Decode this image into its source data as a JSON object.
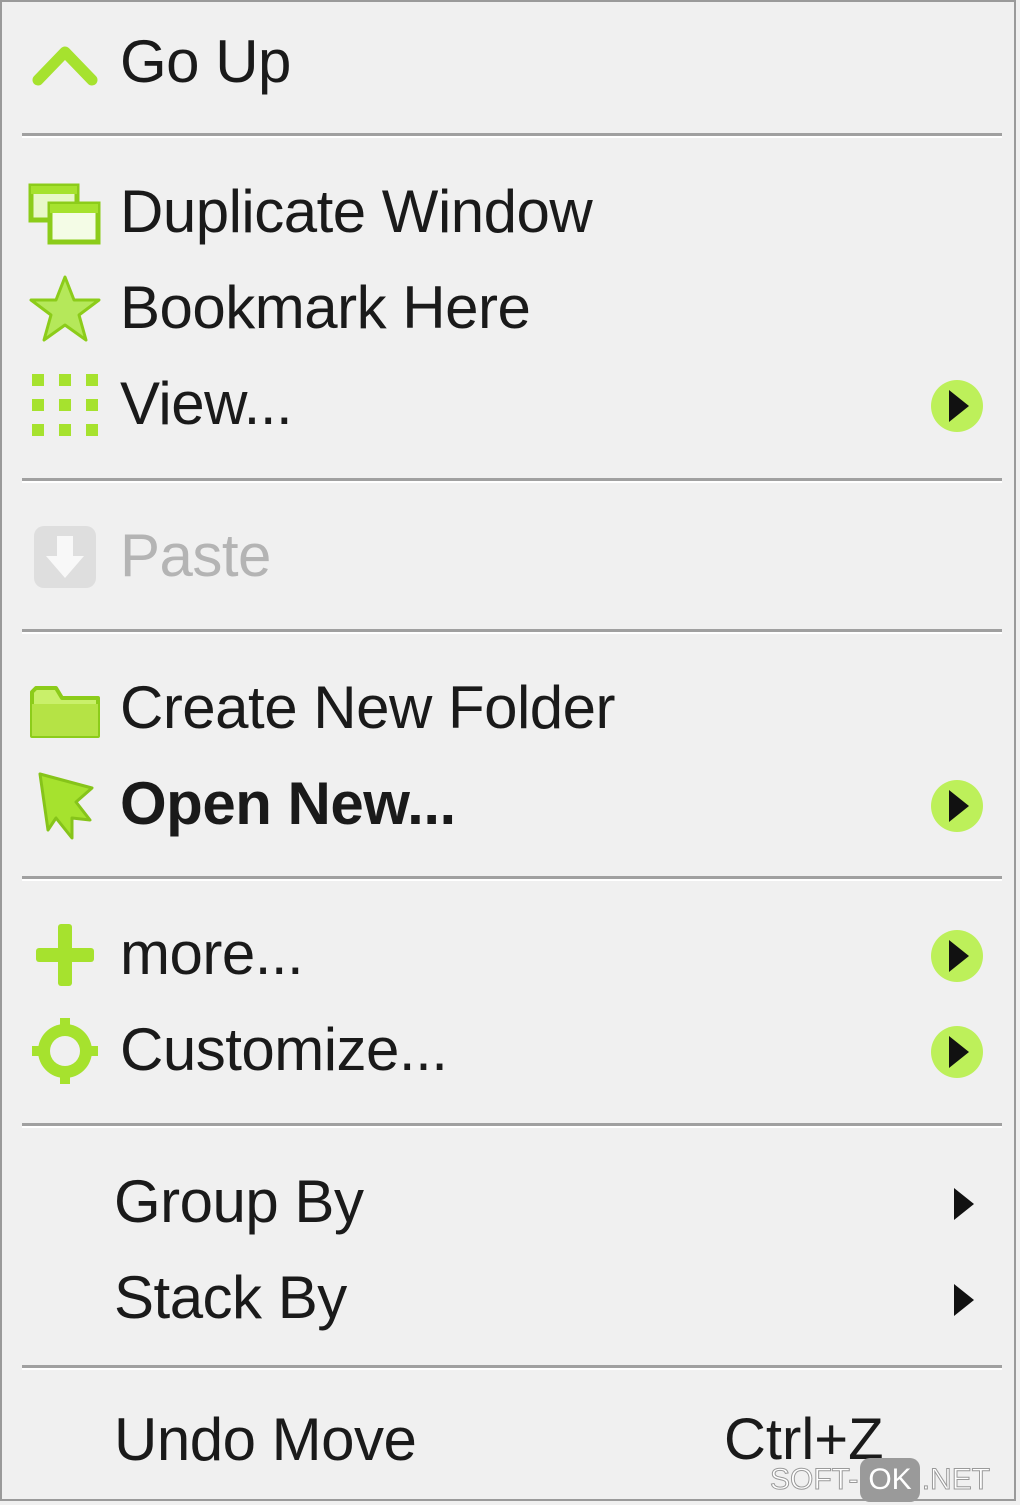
{
  "menu": {
    "items": [
      {
        "label": "Go Up",
        "icon": "go-up-icon"
      },
      {
        "label": "Duplicate Window",
        "icon": "duplicate-window-icon"
      },
      {
        "label": "Bookmark Here",
        "icon": "star-icon"
      },
      {
        "label": "View...",
        "icon": "view-grid-icon",
        "submenu": true
      },
      {
        "label": "Paste",
        "icon": "paste-icon",
        "disabled": true
      },
      {
        "label": "Create New Folder",
        "icon": "folder-icon"
      },
      {
        "label": "Open New...",
        "icon": "open-new-flag-icon",
        "submenu": true,
        "bold": true
      },
      {
        "label": "more...",
        "icon": "plus-icon",
        "submenu": true
      },
      {
        "label": "Customize...",
        "icon": "gear-icon",
        "submenu": true
      },
      {
        "label": "Group By",
        "submenu": true
      },
      {
        "label": "Stack By",
        "submenu": true
      },
      {
        "label": "Undo Move",
        "shortcut": "Ctrl+Z"
      }
    ]
  },
  "watermark": {
    "left": "SOFT-",
    "middle": "OK",
    "right": ".NET"
  },
  "colors": {
    "accent": "#a6e22e",
    "background": "#f0f0f0",
    "text": "#1a1a1a",
    "disabled_text": "#b4b4b4",
    "separator": "#a0a0a0"
  }
}
